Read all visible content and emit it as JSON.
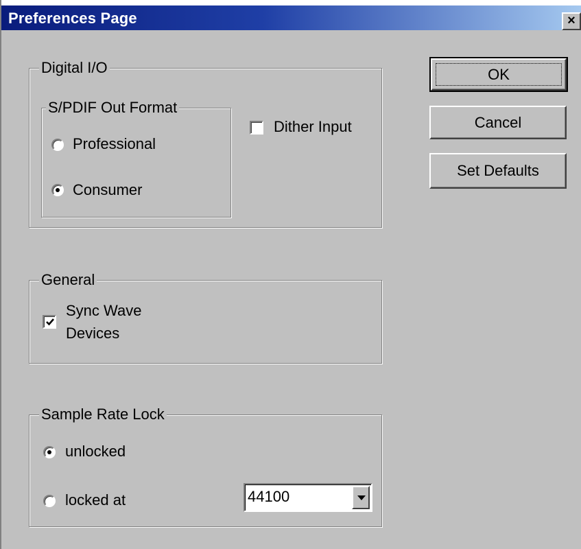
{
  "window": {
    "title": "Preferences Page",
    "close_glyph": "×"
  },
  "buttons": {
    "ok": "OK",
    "cancel": "Cancel",
    "set_defaults": "Set Defaults"
  },
  "digital_io": {
    "group_label": "Digital I/O",
    "spdif": {
      "group_label": "S/PDIF Out Format",
      "options": [
        {
          "label": "Professional",
          "selected": false
        },
        {
          "label": "Consumer",
          "selected": true
        }
      ]
    },
    "dither_input": {
      "label": "Dither Input",
      "checked": false
    }
  },
  "general": {
    "group_label": "General",
    "sync_wave_devices": {
      "label_line1": "Sync Wave",
      "label_line2": "Devices",
      "checked": true
    }
  },
  "sample_rate_lock": {
    "group_label": "Sample Rate Lock",
    "options": [
      {
        "label": "unlocked",
        "selected": true
      },
      {
        "label": "locked at",
        "selected": false
      }
    ],
    "rate_select": {
      "value": "44100"
    }
  },
  "colors": {
    "face": "#c0c0c0",
    "titlebar_start": "#0a1c7c",
    "titlebar_end": "#a6caf0"
  },
  "icons": [
    "close-icon",
    "checkmark-icon",
    "dropdown-arrow-icon"
  ]
}
